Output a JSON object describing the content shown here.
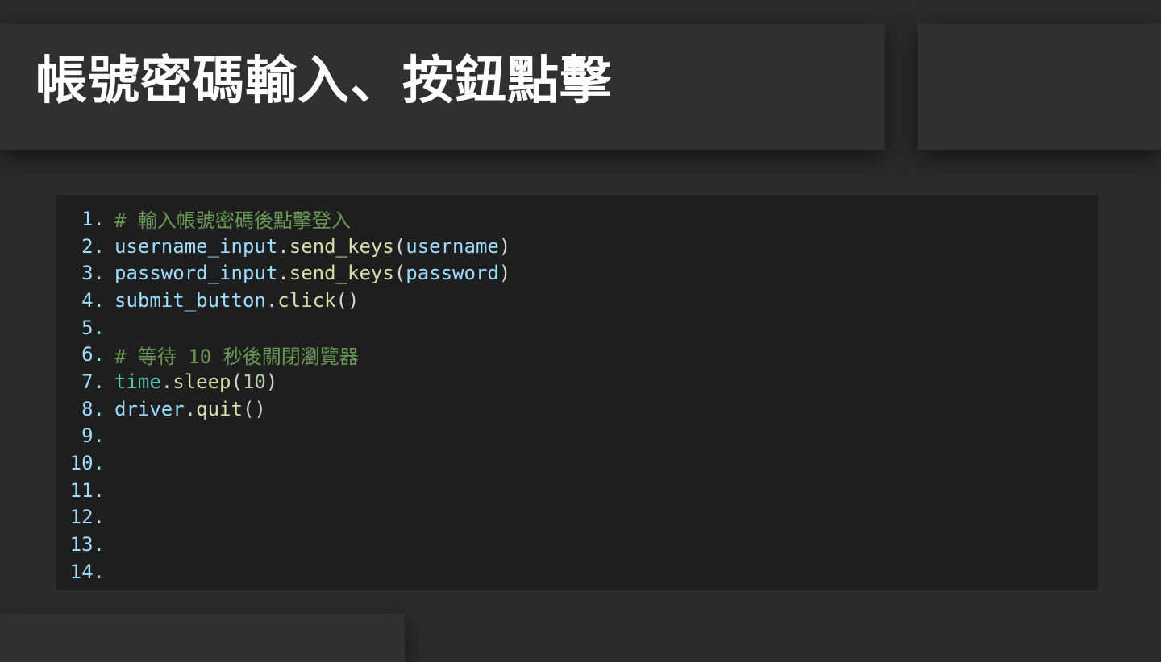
{
  "slide": {
    "title": "帳號密碼輸入、按鈕點擊"
  },
  "code": {
    "lines": [
      {
        "no": "1.",
        "tokens": [
          {
            "t": "# 輸入帳號密碼後點擊登入",
            "k": "comment"
          }
        ]
      },
      {
        "no": "2.",
        "tokens": [
          {
            "t": "username_input",
            "k": "var"
          },
          {
            "t": ".",
            "k": "punc"
          },
          {
            "t": "send_keys",
            "k": "fn"
          },
          {
            "t": "(",
            "k": "punc"
          },
          {
            "t": "username",
            "k": "var"
          },
          {
            "t": ")",
            "k": "punc"
          }
        ]
      },
      {
        "no": "3.",
        "tokens": [
          {
            "t": "password_input",
            "k": "var"
          },
          {
            "t": ".",
            "k": "punc"
          },
          {
            "t": "send_keys",
            "k": "fn"
          },
          {
            "t": "(",
            "k": "punc"
          },
          {
            "t": "password",
            "k": "var"
          },
          {
            "t": ")",
            "k": "punc"
          }
        ]
      },
      {
        "no": "4.",
        "tokens": [
          {
            "t": "submit_button",
            "k": "var"
          },
          {
            "t": ".",
            "k": "punc"
          },
          {
            "t": "click",
            "k": "fn"
          },
          {
            "t": "()",
            "k": "punc"
          }
        ]
      },
      {
        "no": "5.",
        "tokens": []
      },
      {
        "no": "6.",
        "tokens": [
          {
            "t": "# 等待 10 秒後關閉瀏覽器",
            "k": "comment"
          }
        ]
      },
      {
        "no": "7.",
        "tokens": [
          {
            "t": "time",
            "k": "cls"
          },
          {
            "t": ".",
            "k": "punc"
          },
          {
            "t": "sleep",
            "k": "fn"
          },
          {
            "t": "(",
            "k": "punc"
          },
          {
            "t": "10",
            "k": "num"
          },
          {
            "t": ")",
            "k": "punc"
          }
        ]
      },
      {
        "no": "8.",
        "tokens": [
          {
            "t": "driver",
            "k": "var"
          },
          {
            "t": ".",
            "k": "punc"
          },
          {
            "t": "quit",
            "k": "fn"
          },
          {
            "t": "()",
            "k": "punc"
          }
        ]
      },
      {
        "no": "9.",
        "tokens": []
      },
      {
        "no": "10.",
        "tokens": []
      },
      {
        "no": "11.",
        "tokens": []
      },
      {
        "no": "12.",
        "tokens": []
      },
      {
        "no": "13.",
        "tokens": []
      },
      {
        "no": "14.",
        "tokens": []
      }
    ]
  },
  "colors": {
    "background": "#2b2b2b",
    "code_background": "#1e1e1e",
    "line_number": "#9cdcfe",
    "comment": "#6a9955",
    "variable": "#9cdcfe",
    "function": "#dcdcaa",
    "class": "#4ec9b0",
    "number": "#b5cea8"
  }
}
